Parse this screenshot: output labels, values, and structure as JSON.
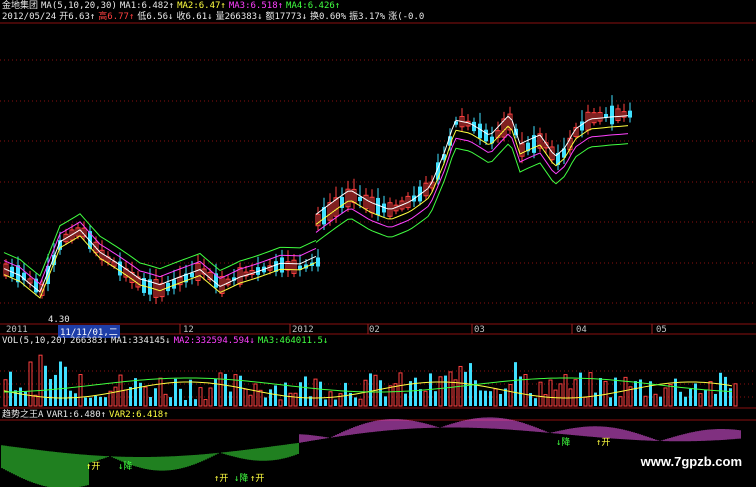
{
  "header": {
    "name": "金地集团",
    "ma_label": "MA(5,10,20,30)",
    "ma1": "MA1:6.482↑",
    "ma2": "MA2:6.47↑",
    "ma3": "MA3:6.518↑",
    "ma4": "MA4:6.426↑",
    "date": "2012/05/24",
    "open": "开6.63↑",
    "high": "高6.77↑",
    "low": "低6.56↓",
    "close": "收6.61↓",
    "volume": "量266383↓",
    "amount": "额17773↓",
    "turnover": "换0.60%",
    "amplitude": "振3.17%",
    "change": "涨(-0.0"
  },
  "price_chart": {
    "low_marker": "4.30",
    "axis_labels": [
      "2011",
      "11/11/01,二",
      "12",
      "2012",
      "02",
      "03",
      "04",
      "05"
    ]
  },
  "volume_panel": {
    "label": "VOL(5,10,20)",
    "vol": "266383↓",
    "ma1": "MA1:334145↓",
    "ma2": "MA2:332594.594↓",
    "ma3": "MA3:464011.5↓"
  },
  "indicator_panel": {
    "label": "趋势之王A",
    "var1": "VAR1:6.480↑",
    "var2": "VAR2:6.418↑",
    "signals": [
      "↑开",
      "↓降",
      "↑开",
      "↓降",
      "↑开",
      "↓降",
      "↑开"
    ]
  },
  "watermark": "www.7gpzb.com",
  "colors": {
    "up": "#ff4040",
    "down": "#40e0ff",
    "ma1": "#ffffff",
    "ma2": "#ffff40",
    "ma3": "#ff40ff",
    "ma4": "#40ff40",
    "grid": "#8a1010"
  }
}
